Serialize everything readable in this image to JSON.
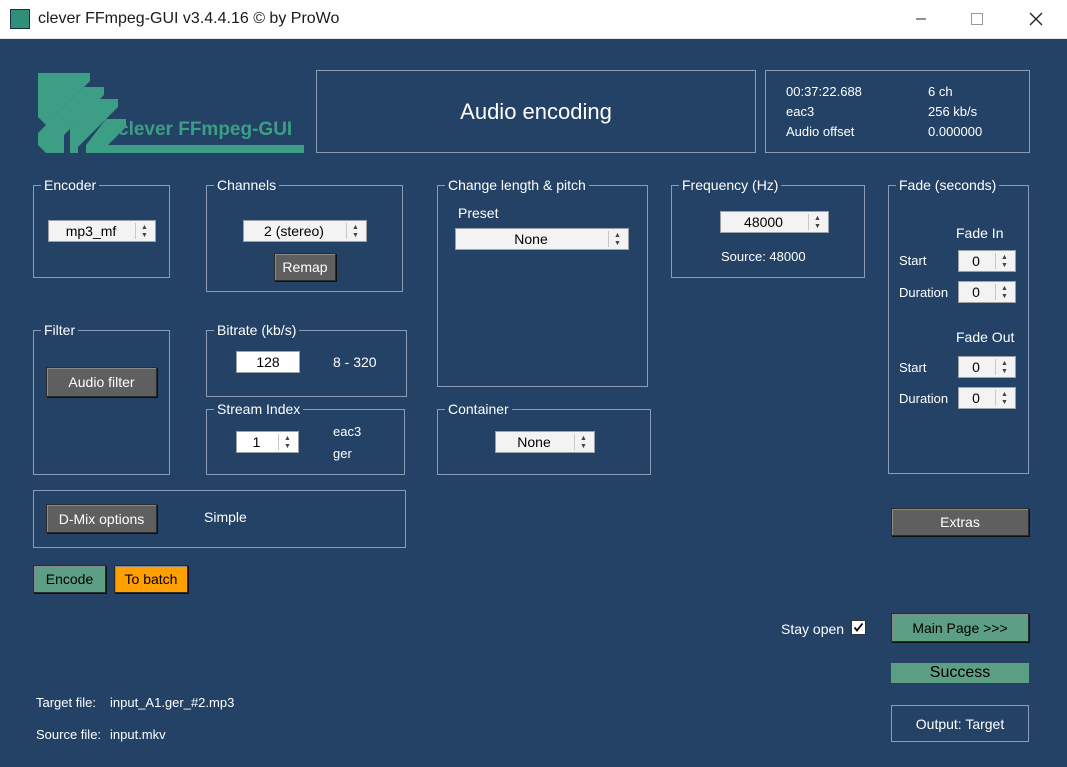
{
  "window": {
    "title": "clever FFmpeg-GUI v3.4.4.16   © by ProWo",
    "minimize_icon": "minimize-icon",
    "maximize_icon": "maximize-icon",
    "close_icon": "close-icon"
  },
  "logo": {
    "text": "clever FFmpeg-GUI"
  },
  "header": {
    "title": "Audio encoding"
  },
  "info": {
    "duration": "00:37:22.688",
    "channels": "6 ch",
    "codec": "eac3",
    "bitrate": "256 kb/s",
    "offset_label": "Audio offset",
    "offset_value": "0.000000"
  },
  "encoder": {
    "label": "Encoder",
    "value": "mp3_mf"
  },
  "channels": {
    "label": "Channels",
    "value": "2 (stereo)",
    "remap_button": "Remap"
  },
  "change_length": {
    "label": "Change length & pitch",
    "preset_label": "Preset",
    "preset_value": "None"
  },
  "frequency": {
    "label": "Frequency (Hz)",
    "value": "48000",
    "source": "Source: 48000"
  },
  "fade": {
    "label": "Fade (seconds)",
    "fade_in_label": "Fade In",
    "fade_out_label": "Fade Out",
    "start_label": "Start",
    "duration_label": "Duration",
    "in_start": "0",
    "in_duration": "0",
    "out_start": "0",
    "out_duration": "0"
  },
  "filter": {
    "label": "Filter",
    "button": "Audio filter"
  },
  "bitrate": {
    "label": "Bitrate (kb/s)",
    "value": "128",
    "range": "8 - 320"
  },
  "stream_index": {
    "label": "Stream Index",
    "value": "1",
    "codec": "eac3",
    "lang": "ger"
  },
  "container": {
    "label": "Container",
    "value": "None"
  },
  "dmix": {
    "button": "D-Mix options",
    "mode": "Simple"
  },
  "actions": {
    "encode": "Encode",
    "to_batch": "To batch",
    "extras": "Extras",
    "main_page": "Main Page >>>"
  },
  "stay_open": {
    "label": "Stay open",
    "checked": true
  },
  "status": {
    "text": "Success"
  },
  "output": {
    "button": "Output: Target"
  },
  "files": {
    "target_label": "Target file:",
    "target_value": "input_A1.ger_#2.mp3",
    "source_label": "Source file:",
    "source_value": "input.mkv"
  },
  "colors": {
    "background": "#234266",
    "accent_green": "#5d9f86",
    "logo_green": "#3c9e84",
    "batch_orange": "#ff9f00",
    "button_gray": "#5f5f5f"
  }
}
